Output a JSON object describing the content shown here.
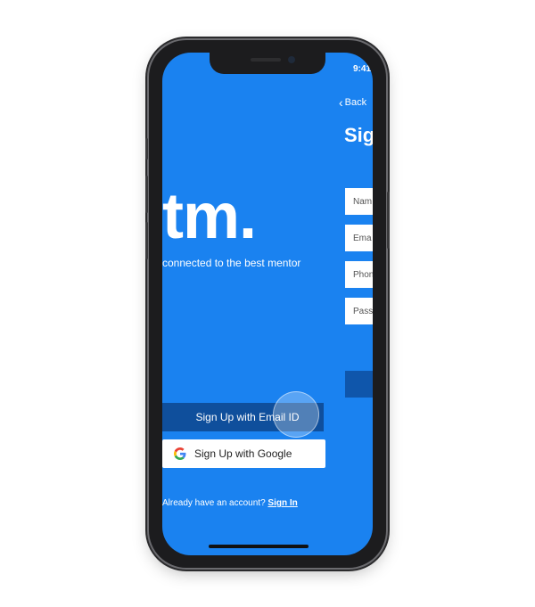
{
  "status_bar": {
    "time": "9:41"
  },
  "welcome": {
    "logo_fragment": "tm.",
    "tagline": "connected to the best mentor",
    "email_button": "Sign Up with Email ID",
    "google_button": "Sign Up with Google",
    "signin_prompt": "Already have an account?",
    "signin_link": "Sign In"
  },
  "next_screen": {
    "back_label": "Back",
    "title_fragment": "Sig",
    "fields": [
      "Nam",
      "Ema",
      "Phon",
      "Pass"
    ]
  },
  "colors": {
    "screen_bg": "#1a82f0",
    "email_button_bg": "#0f4f9c",
    "google_button_bg": "#ffffff"
  }
}
